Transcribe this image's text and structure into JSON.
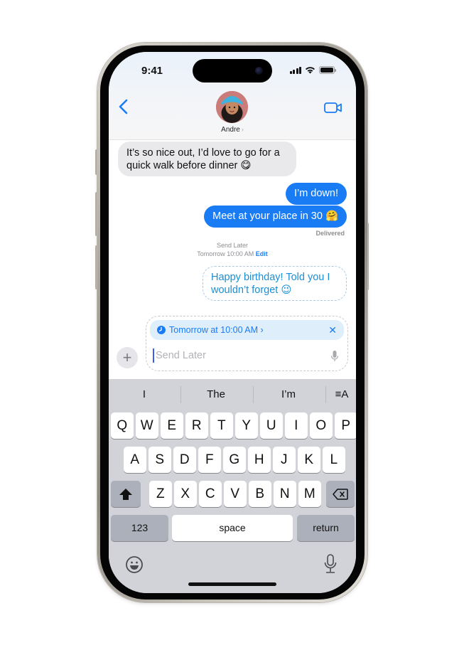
{
  "status_bar": {
    "time": "9:41",
    "icons": [
      "signal-icon",
      "wifi-icon",
      "battery-icon"
    ]
  },
  "header": {
    "back_icon": "chevron-left-icon",
    "contact_name": "Andre",
    "contact_chevron": "›",
    "video_icon": "video-camera-icon"
  },
  "messages": [
    {
      "direction": "incoming",
      "text": "It’s so nice out, I’d love to go for a quick walk before dinner 😋"
    },
    {
      "direction": "outgoing",
      "text": "I’m down!"
    },
    {
      "direction": "outgoing",
      "text": "Meet at your place in 30 🤗"
    }
  ],
  "delivered_label": "Delivered",
  "scheduled": {
    "title": "Send Later",
    "time": "Tomorrow 10:00 AM",
    "edit_label": "Edit",
    "message_text": "Happy birthday! Told you I wouldn’t forget 😉"
  },
  "compose": {
    "plus_label": "+",
    "schedule_pill": "Tomorrow at 10:00 AM ›",
    "schedule_close": "✕",
    "input_placeholder": "Send Later",
    "input_value": ""
  },
  "keyboard": {
    "suggestions": [
      "I",
      "The",
      "I’m"
    ],
    "format_icon_label": "≡A",
    "rows": [
      [
        "Q",
        "W",
        "E",
        "R",
        "T",
        "Y",
        "U",
        "I",
        "O",
        "P"
      ],
      [
        "A",
        "S",
        "D",
        "F",
        "G",
        "H",
        "J",
        "K",
        "L"
      ],
      [
        "Z",
        "X",
        "C",
        "V",
        "B",
        "N",
        "M"
      ]
    ],
    "numbers_label": "123",
    "space_label": "space",
    "return_label": "return",
    "shift_icon": "shift-icon",
    "delete_icon": "delete-icon",
    "emoji_icon": "emoji-icon",
    "dictation_icon": "microphone-icon"
  }
}
